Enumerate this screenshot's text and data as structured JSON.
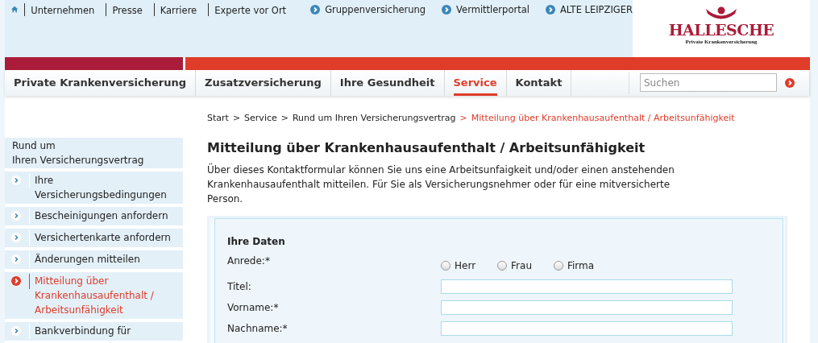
{
  "top_links": [
    {
      "label": "Unternehmen"
    },
    {
      "label": "Presse"
    },
    {
      "label": "Karriere"
    },
    {
      "label": "Experte vor Ort"
    }
  ],
  "external_links": [
    {
      "label": "Gruppenversicherung"
    },
    {
      "label": "Vermittlerportal"
    },
    {
      "label": "ALTE LEIPZIGER"
    }
  ],
  "logo": {
    "name": "HALLESCHE",
    "subtitle": "Private Krankenversicherung"
  },
  "main_nav": [
    {
      "label": "Private Krankenversicherung",
      "selected": false
    },
    {
      "label": "Zusatzversicherung",
      "selected": false
    },
    {
      "label": "Ihre Gesundheit",
      "selected": false
    },
    {
      "label": "Service",
      "selected": true
    },
    {
      "label": "Kontakt",
      "selected": false
    }
  ],
  "search": {
    "placeholder": "Suchen"
  },
  "breadcrumb": {
    "separator": ">",
    "items": [
      {
        "label": "Start",
        "current": false
      },
      {
        "label": "Service",
        "current": false
      },
      {
        "label": "Rund um Ihren Versicherungsvertrag",
        "current": false
      },
      {
        "label": "Mitteilung über Krankenhausaufenthalt / Arbeitsunfähigkeit",
        "current": true
      }
    ]
  },
  "sidebar": {
    "heading": "Rund um\nIhren Versicherungsvertrag",
    "items": [
      {
        "label": "Ihre\nVersicherungsbedingungen",
        "selected": false
      },
      {
        "label": "Bescheinigungen anfordern",
        "selected": false
      },
      {
        "label": "Versichertenkarte anfordern",
        "selected": false
      },
      {
        "label": "Änderungen mitteilen",
        "selected": false
      },
      {
        "label": "Mitteilung über\nKrankenhausaufenthalt /\nArbeitsunfähigkeit",
        "selected": true
      },
      {
        "label": "Bankverbindung für",
        "selected": false
      }
    ]
  },
  "title": "Mitteilung über Krankenhausaufenthalt / Arbeitsunfähigkeit",
  "intro": "Über dieses Kontaktformular können Sie uns eine Arbeitsunfaigkeit und/oder einen anstehenden\nKrankenhausaufenthalt mitteilen. Für Sie als Versicherungsnehmer oder für eine mitversicherte\nPerson.",
  "form": {
    "section_title": "Ihre Daten",
    "fields": [
      {
        "kind": "radio",
        "label": "Anrede:*",
        "options": [
          {
            "label": "Herr",
            "selected": false
          },
          {
            "label": "Frau",
            "selected": false
          },
          {
            "label": "Firma",
            "selected": false
          }
        ]
      },
      {
        "kind": "text",
        "label": "Titel:"
      },
      {
        "kind": "text",
        "label": "Vorname:*"
      },
      {
        "kind": "text",
        "label": "Nachname:*"
      }
    ]
  }
}
